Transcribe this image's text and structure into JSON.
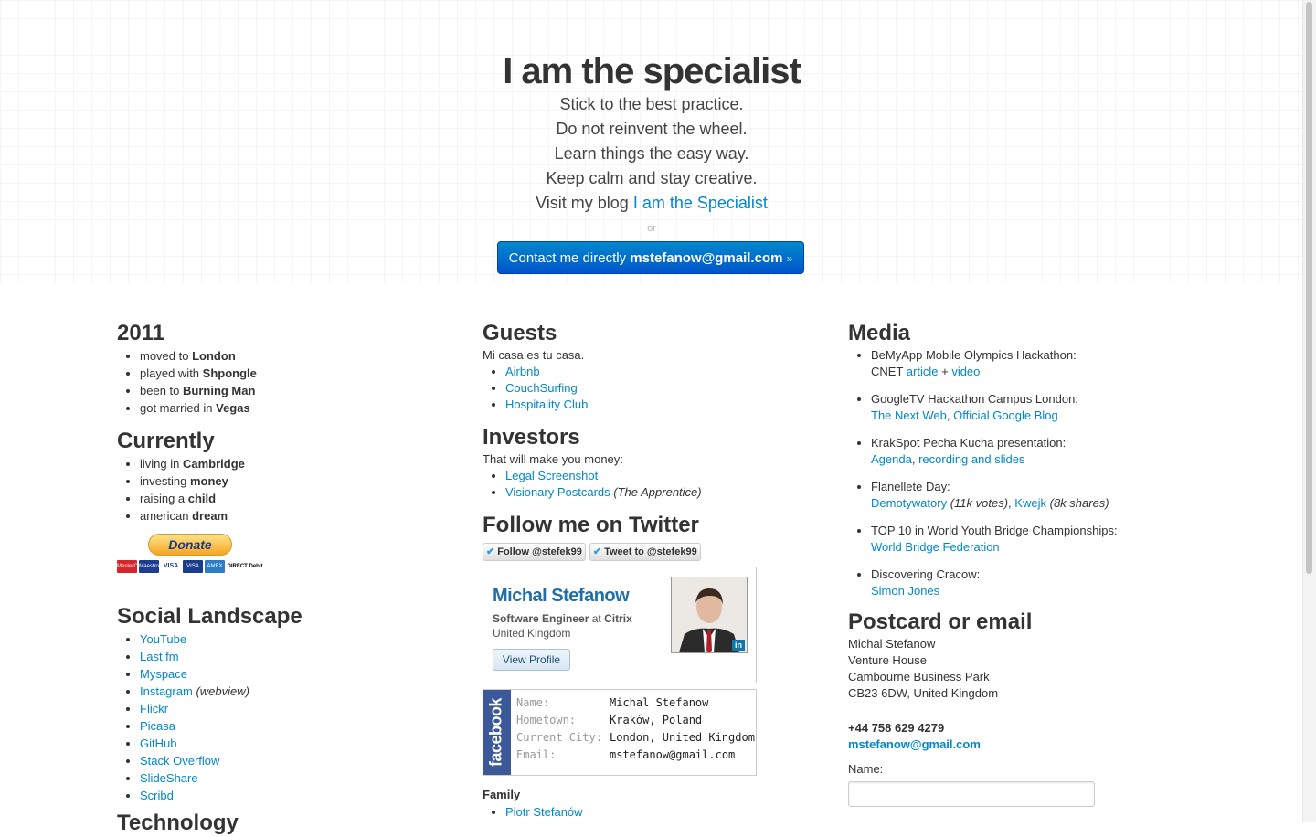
{
  "hero": {
    "title": "I am the specialist",
    "lines": [
      "Stick to the best practice.",
      "Do not reinvent the wheel.",
      "Learn things the easy way.",
      "Keep calm and stay creative."
    ],
    "blog_prefix": "Visit my blog",
    "blog_link": "I am the Specialist",
    "or": "or",
    "contact_prefix": "Contact me directly",
    "contact_email": "mstefanow@gmail.com",
    "contact_suffix": "»"
  },
  "year2011": {
    "heading": "2011",
    "items": [
      {
        "text": "moved to",
        "bold": "London"
      },
      {
        "text": "played with",
        "bold": "Shpongle"
      },
      {
        "text": "been to",
        "bold": "Burning Man"
      },
      {
        "text": "got married in",
        "bold": "Vegas"
      }
    ]
  },
  "currently": {
    "heading": "Currently",
    "items": [
      {
        "text": "living in",
        "bold": "Cambridge"
      },
      {
        "text": "investing",
        "bold": "money"
      },
      {
        "text": "raising a",
        "bold": "child"
      },
      {
        "text": "american",
        "bold": "dream"
      }
    ]
  },
  "donate": {
    "label": "Donate",
    "cards": [
      "MasterCard",
      "Maestro",
      "VISA",
      "VISA",
      "AMEX",
      "DIRECT Debit"
    ]
  },
  "social": {
    "heading": "Social Landscape",
    "items": [
      {
        "label": "YouTube",
        "note": ""
      },
      {
        "label": "Last.fm",
        "note": ""
      },
      {
        "label": "Myspace",
        "note": ""
      },
      {
        "label": "Instagram",
        "note": "(webview)"
      },
      {
        "label": "Flickr",
        "note": ""
      },
      {
        "label": "Picasa",
        "note": ""
      },
      {
        "label": "GitHub",
        "note": ""
      },
      {
        "label": "Stack Overflow",
        "note": ""
      },
      {
        "label": "SlideShare",
        "note": ""
      },
      {
        "label": "Scribd",
        "note": ""
      }
    ],
    "next_heading": "Technology"
  },
  "guests": {
    "heading": "Guests",
    "intro": "Mi casa es tu casa.",
    "items": [
      "Airbnb",
      "CouchSurfing",
      "Hospitality Club"
    ]
  },
  "investors": {
    "heading": "Investors",
    "intro": "That will make you money:",
    "items": [
      {
        "label": "Legal Screenshot",
        "note": ""
      },
      {
        "label": "Visionary Postcards",
        "note": "(The Apprentice)"
      }
    ]
  },
  "twitter": {
    "heading": "Follow me on Twitter",
    "follow_label": "Follow @stefek99",
    "tweet_label": "Tweet to @stefek99"
  },
  "linkedin": {
    "name": "Michal Stefanow",
    "role": "Software Engineer",
    "at": "at",
    "company": "Citrix",
    "location": "United Kingdom",
    "view_profile": "View Profile",
    "badge": "in"
  },
  "facebook": {
    "brand": "facebook",
    "rows": [
      {
        "key": "Name:",
        "value": "Michal Stefanow"
      },
      {
        "key": "Hometown:",
        "value": "Kraków, Poland"
      },
      {
        "key": "Current City:",
        "value": "London, United Kingdom"
      },
      {
        "key": "Email:",
        "value": "mstefanow@gmail.com"
      }
    ]
  },
  "family": {
    "heading": "Family",
    "items": [
      "Piotr Stefanów"
    ]
  },
  "media": {
    "heading": "Media",
    "items": [
      {
        "title": "BeMyApp Mobile Olympics Hackathon:",
        "line2": "CNET",
        "links": [
          "article",
          "video"
        ],
        "sep": "+"
      },
      {
        "title": "GoogleTV Hackathon Campus London:",
        "line2": "",
        "links": [
          "The Next Web",
          "Official Google Blog"
        ],
        "sep": ","
      },
      {
        "title": "KrakSpot Pecha Kucha presentation:",
        "line2": "",
        "links": [
          "Agenda",
          "recording and slides"
        ],
        "sep": ","
      },
      {
        "title": "Flanellete Day:",
        "line2": "",
        "links": [
          "Demotywatory",
          "Kwejk"
        ],
        "notes": [
          "(11k votes)",
          "(8k shares)"
        ],
        "sep": ","
      },
      {
        "title": "TOP 10 in World Youth Bridge Championships:",
        "line2": "",
        "links": [
          "World Bridge Federation"
        ],
        "sep": ""
      },
      {
        "title": "Discovering Cracow:",
        "line2": "",
        "links": [
          "Simon Jones"
        ],
        "sep": ""
      }
    ]
  },
  "postcard": {
    "heading": "Postcard or email",
    "address": [
      "Michal Stefanow",
      "Venture House",
      "Cambourne Business Park",
      "CB23 6DW, United Kingdom"
    ],
    "phone": "+44 758 629 4279",
    "email": "mstefanow@gmail.com",
    "name_label": "Name:"
  },
  "colors": {
    "link": "#0088cc",
    "button": "#0066cc",
    "linkedin_name": "#1f6fa8",
    "facebook": "#3b5998"
  }
}
